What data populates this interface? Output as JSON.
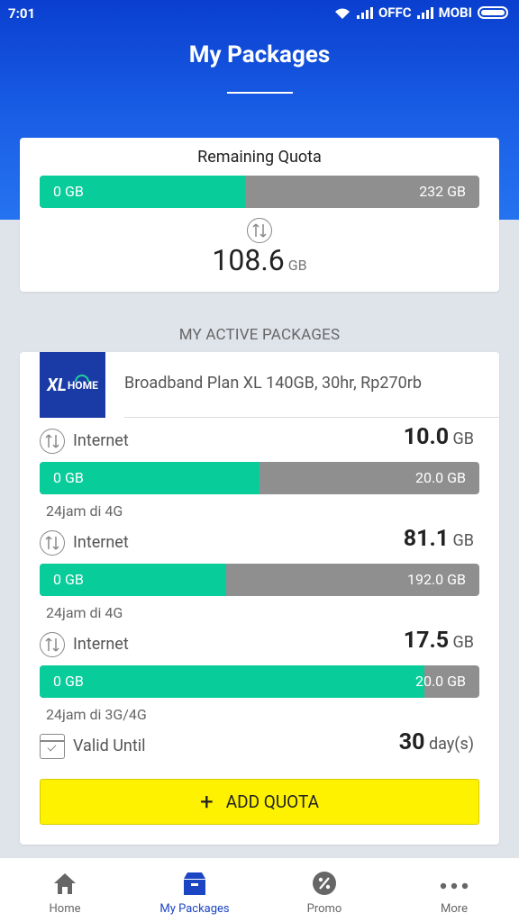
{
  "status_bar": {
    "time": "7:01",
    "carrier1": "OFFC",
    "carrier2": "MOBI"
  },
  "header": {
    "title": "My Packages"
  },
  "remaining": {
    "title": "Remaining Quota",
    "bar_min": "0 GB",
    "bar_max": "232 GB",
    "fill_fraction": 0.468,
    "amount": "108.6",
    "unit": "GB"
  },
  "section_title": "MY ACTIVE PACKAGES",
  "package": {
    "logo_xl": "XL",
    "logo_home": "HOME",
    "name": "Broadband Plan XL 140GB, 30hr, Rp270rb",
    "quotas": [
      {
        "label": "Internet",
        "amount": "10.0",
        "unit": "GB",
        "bar_min": "0 GB",
        "bar_max": "20.0 GB",
        "fill_fraction": 0.5,
        "note": "24jam di 4G"
      },
      {
        "label": "Internet",
        "amount": "81.1",
        "unit": "GB",
        "bar_min": "0 GB",
        "bar_max": "192.0 GB",
        "fill_fraction": 0.424,
        "note": "24jam di 4G"
      },
      {
        "label": "Internet",
        "amount": "17.5",
        "unit": "GB",
        "bar_min": "0 GB",
        "bar_max": "20.0 GB",
        "fill_fraction": 0.875,
        "note": "24jam di 3G/4G"
      }
    ],
    "valid": {
      "label": "Valid Until",
      "amount": "30",
      "unit": "day(s)"
    },
    "add_button": "ADD QUOTA"
  },
  "nav": {
    "items": [
      {
        "label": "Home"
      },
      {
        "label": "My Packages"
      },
      {
        "label": "Promo"
      },
      {
        "label": "More"
      }
    ]
  },
  "colors": {
    "header": "#1a5fe6",
    "fill": "#08cc9a",
    "bar_bg": "#8f8f8f",
    "button": "#fff200",
    "nav_active": "#1c45c4"
  }
}
